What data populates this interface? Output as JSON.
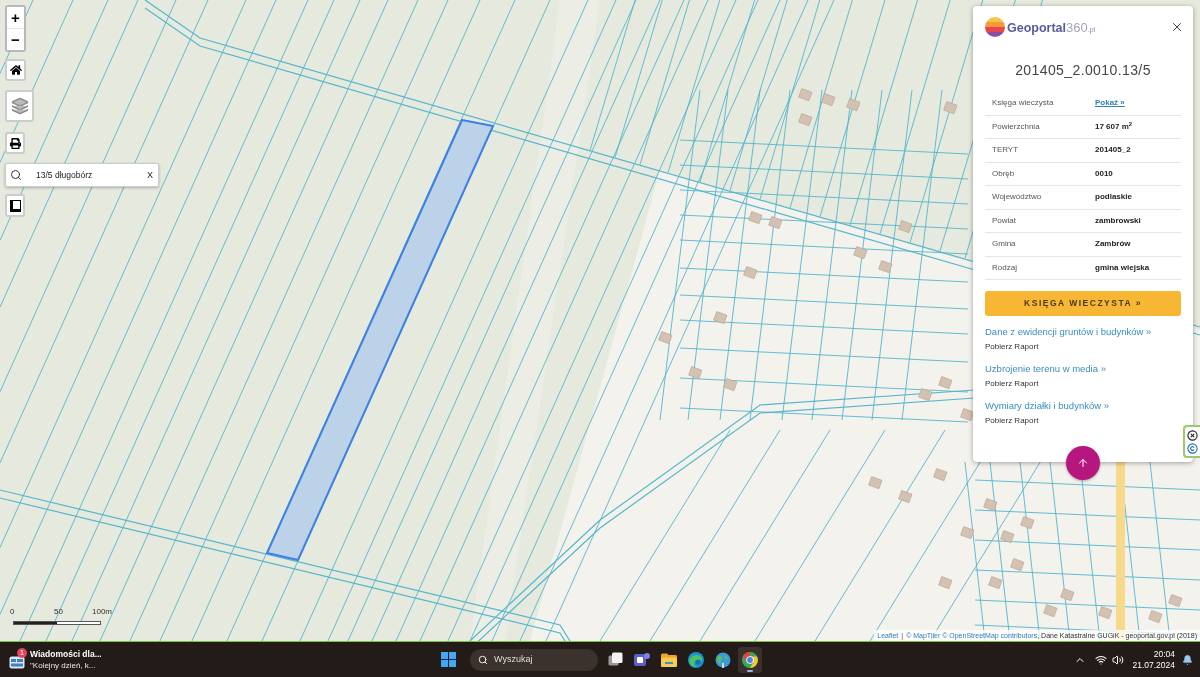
{
  "map_controls": {
    "zoom": [
      "+",
      "−"
    ],
    "search": {
      "value": "13/5 długobórz",
      "clear": "X"
    }
  },
  "scale": {
    "labels": [
      "0",
      "50",
      "100m"
    ]
  },
  "attribution": [
    {
      "kind": "link",
      "text": "Leaflet"
    },
    {
      "kind": "separator",
      "text": "|"
    },
    {
      "kind": "link",
      "text": "© MapTiler © OpenStreetMap contributors"
    },
    {
      "kind": "text",
      "text": ", Dane Katastralne GUGiK - geoportal.gov.pl (2018)"
    }
  ],
  "info_panel": {
    "logo": {
      "brand": "Geoportal",
      "number": "360",
      "domain": ".pl"
    },
    "title": "201405_2.0010.13/5",
    "rows": [
      {
        "label": "Księga wieczysta",
        "value": "Pokaż »",
        "kind": "link"
      },
      {
        "label": "Powierzchnia",
        "value": "17 607 m$^{2}$",
        "kind": "text"
      },
      {
        "label": "TERYT",
        "value": "201405_2",
        "kind": "text"
      },
      {
        "label": "Obręb",
        "value": "0010",
        "kind": "text"
      },
      {
        "label": "Województwo",
        "value": "podlaskie",
        "kind": "text"
      },
      {
        "label": "Powiat",
        "value": "zambrowski",
        "kind": "text"
      },
      {
        "label": "Gmina",
        "value": "Zambrów",
        "kind": "text"
      },
      {
        "label": "Rodzaj",
        "value": "gmina wiejska",
        "kind": "text"
      }
    ],
    "action_button": "KSIĘGA WIECZYSTA »",
    "reports": [
      {
        "title": "Dane z ewidencji gruntów i budynków »",
        "action": "Pobierz Raport"
      },
      {
        "title": "Uzbrojenie terenu w media »",
        "action": "Pobierz Raport"
      },
      {
        "title": "Wymiary działki i budynków »",
        "action": "Pobierz Raport"
      }
    ]
  },
  "taskbar": {
    "widget": {
      "badge": "1",
      "title": "Wiadomości dla...",
      "subtitle": "\"Kolejny dzień, k..."
    },
    "search": {
      "placeholder": "Wyszukaj"
    },
    "apps": [
      {
        "kind": "task-view",
        "selected": false
      },
      {
        "kind": "chat",
        "selected": false
      },
      {
        "kind": "folder",
        "selected": false
      },
      {
        "kind": "edge",
        "selected": false
      },
      {
        "kind": "globe",
        "selected": false
      },
      {
        "kind": "chrome",
        "selected": true
      }
    ],
    "clock": {
      "time": "20:04",
      "date": "21.07.2024"
    }
  }
}
